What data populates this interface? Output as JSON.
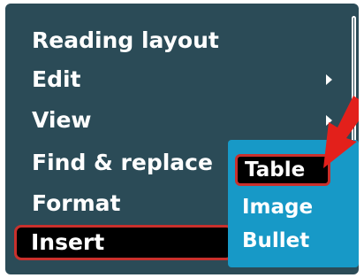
{
  "menu": {
    "items": [
      {
        "label": "Reading layout"
      },
      {
        "label": "Edit"
      },
      {
        "label": "View"
      },
      {
        "label": "Find & replace"
      },
      {
        "label": "Format"
      },
      {
        "label": "Insert"
      }
    ],
    "selected": "Insert"
  },
  "submenu": {
    "items": [
      {
        "label": "Table"
      },
      {
        "label": "Image"
      },
      {
        "label": "Bullet"
      }
    ],
    "selected": "Table"
  },
  "colors": {
    "menu_background": "#2b4b57",
    "submenu_background": "#1799c7",
    "highlight_border": "#c9302c",
    "selection_fill": "#000000",
    "pointer_arrow": "#e3201b"
  },
  "icons": [
    "chevron-right-icon",
    "scrollbar",
    "red-pointer-arrow-icon"
  ]
}
